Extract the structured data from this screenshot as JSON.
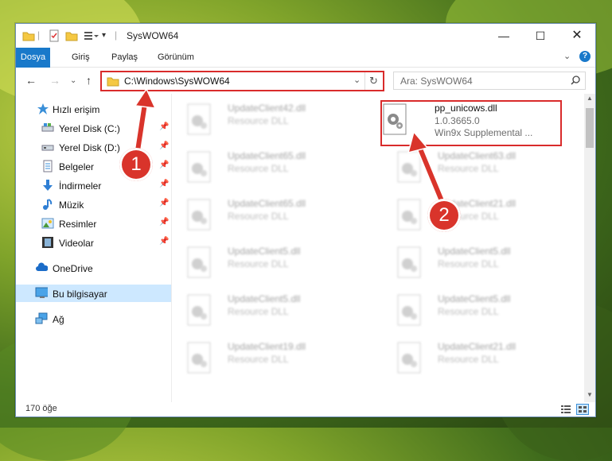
{
  "window": {
    "title": "SysWOW64"
  },
  "ribbon": {
    "tabs": [
      "Dosya",
      "Giriş",
      "Paylaş",
      "Görünüm"
    ]
  },
  "address": {
    "path": "C:\\Windows\\SysWOW64"
  },
  "search": {
    "placeholder": "Ara: SysWOW64"
  },
  "nav": {
    "items": [
      {
        "label": "Hızlı erişim"
      },
      {
        "label": "Yerel Disk (C:)"
      },
      {
        "label": "Yerel Disk (D:)"
      },
      {
        "label": "Belgeler"
      },
      {
        "label": "İndirmeler"
      },
      {
        "label": "Müzik"
      },
      {
        "label": "Resimler"
      },
      {
        "label": "Videolar"
      },
      {
        "label": "OneDrive"
      },
      {
        "label": "Bu bilgisayar"
      },
      {
        "label": "Ağ"
      }
    ]
  },
  "files": {
    "left": [
      {
        "name": "UpdateClient42.dll",
        "type": "Resource DLL"
      },
      {
        "name": "UpdateClient65.dll",
        "type": "Resource DLL"
      },
      {
        "name": "UpdateClient65.dll",
        "type": "Resource DLL"
      },
      {
        "name": "UpdateClient5.dll",
        "type": "Resource DLL"
      },
      {
        "name": "UpdateClient5.dll",
        "type": "Resource DLL"
      },
      {
        "name": "UpdateClient19.dll",
        "type": "Resource DLL"
      }
    ],
    "right": [
      {
        "name": "UpdateClient63.dll",
        "type": "Resource DLL"
      },
      {
        "name": "UpdateClient21.dll",
        "type": "Resource DLL"
      },
      {
        "name": "UpdateClient5.dll",
        "type": "Resource DLL"
      },
      {
        "name": "UpdateClient5.dll",
        "type": "Resource DLL"
      },
      {
        "name": "UpdateClient21.dll",
        "type": "Resource DLL"
      }
    ],
    "highlighted": {
      "name": "pp_unicows.dll",
      "version": "1.0.3665.0",
      "description": "Win9x Supplemental ..."
    }
  },
  "status": {
    "count": "170 öğe"
  },
  "annotations": {
    "step1": "1",
    "step2": "2"
  },
  "colors": {
    "accent": "#1979ca",
    "highlight": "#d92b2b",
    "badge": "#d9342b"
  }
}
